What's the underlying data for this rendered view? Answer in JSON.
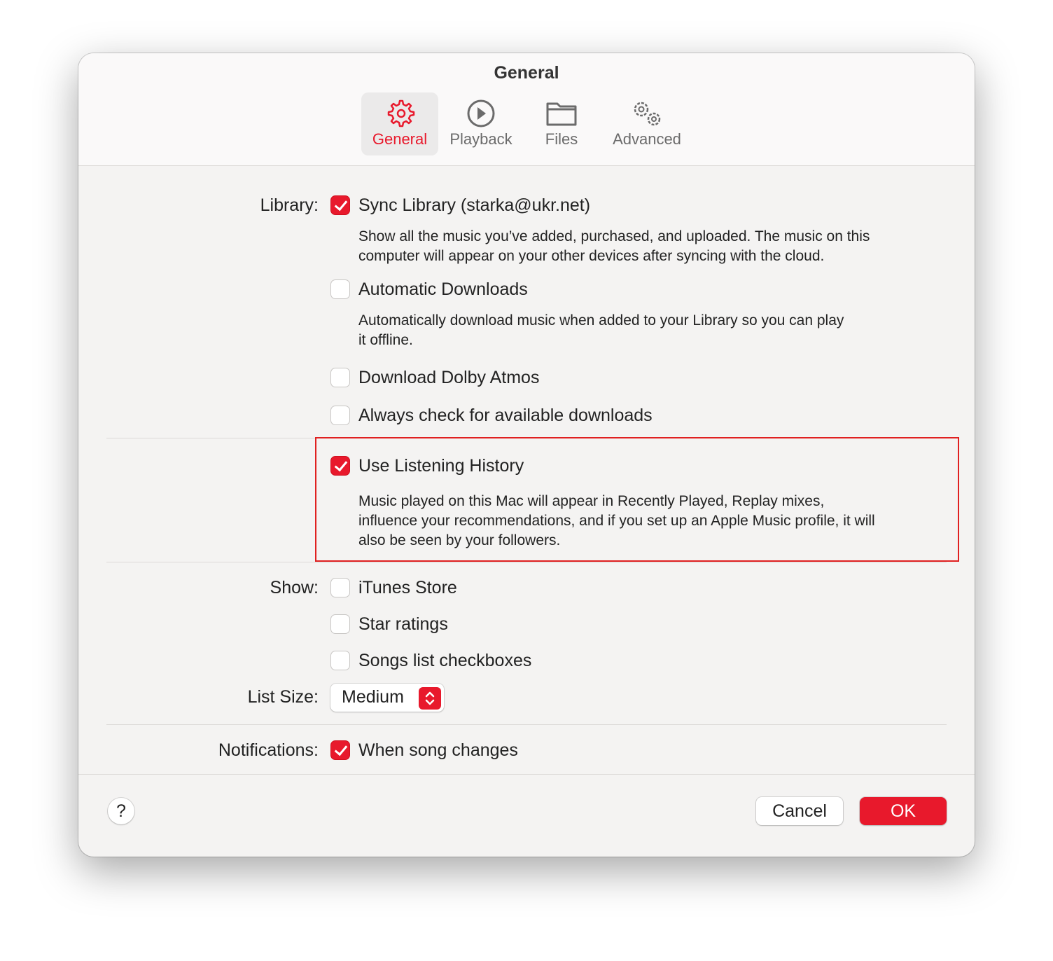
{
  "window": {
    "title": "General"
  },
  "tabs": [
    {
      "label": "General",
      "icon": "gear-icon",
      "selected": true
    },
    {
      "label": "Playback",
      "icon": "play-circle-icon"
    },
    {
      "label": "Files",
      "icon": "folder-icon"
    },
    {
      "label": "Advanced",
      "icon": "gears-icon"
    }
  ],
  "library": {
    "label": "Library:",
    "sync": {
      "label": "Sync Library (starka@ukr.net)",
      "checked": true,
      "desc1": "Show all the music you’ve added, purchased, and uploaded. The music on this",
      "desc2": "computer will appear on your other devices after syncing with the cloud."
    },
    "auto": {
      "label": "Automatic Downloads",
      "checked": false,
      "desc1": "Automatically download music when added to your Library so you can play",
      "desc2": "it offline."
    },
    "dolby": {
      "label": "Download Dolby Atmos",
      "checked": false
    },
    "always": {
      "label": "Always check for available downloads",
      "checked": false
    }
  },
  "history": {
    "label": "Use Listening History",
    "checked": true,
    "desc1": "Music played on this Mac will appear in Recently Played, Replay mixes,",
    "desc2": "influence your recommendations, and if you set up an Apple Music profile, it will",
    "desc3": "also be seen by your followers.",
    "highlight_color": "#e02020"
  },
  "show": {
    "label": "Show:",
    "items": [
      {
        "label": "iTunes Store",
        "checked": false
      },
      {
        "label": "Star ratings",
        "checked": false
      },
      {
        "label": "Songs list checkboxes",
        "checked": false
      }
    ]
  },
  "list_size": {
    "label": "List Size:",
    "value": "Medium"
  },
  "notifications": {
    "label": "Notifications:",
    "option": "When song changes",
    "checked": true
  },
  "footer": {
    "help": "?",
    "cancel": "Cancel",
    "ok": "OK"
  },
  "colors": {
    "accent": "#e8192c"
  }
}
